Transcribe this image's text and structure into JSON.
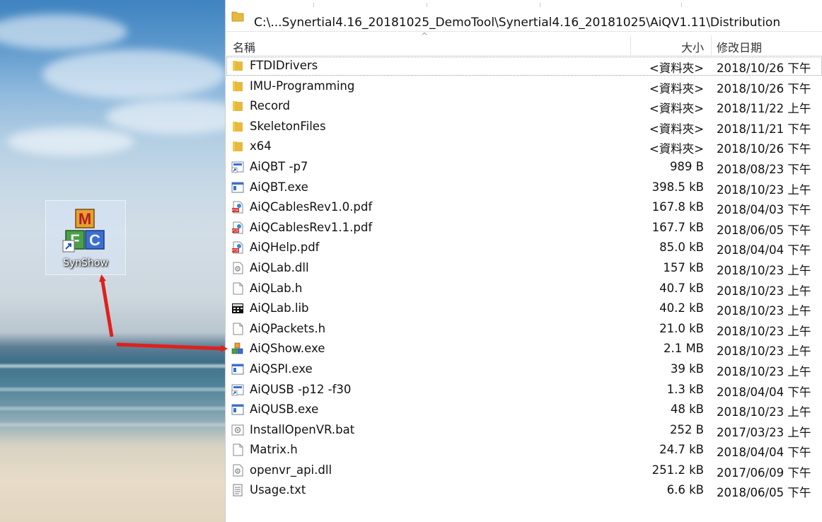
{
  "desktop": {
    "shortcut_label": "SynShow"
  },
  "explorer": {
    "path": "C:\\...Synertial4.16_20181025_DemoTool\\Synertial4.16_20181025\\AiQV1.11\\Distribution",
    "columns": {
      "name": "名稱",
      "size": "大小",
      "date": "修改日期"
    },
    "files": [
      {
        "name": "FTDIDrivers",
        "size": "<資料夾>",
        "date": "2018/10/26 下午",
        "icon": "folder-icon"
      },
      {
        "name": "IMU-Programming",
        "size": "<資料夾>",
        "date": "2018/10/26 下午",
        "icon": "folder-icon"
      },
      {
        "name": "Record",
        "size": "<資料夾>",
        "date": "2018/11/22 上午",
        "icon": "folder-icon"
      },
      {
        "name": "SkeletonFiles",
        "size": "<資料夾>",
        "date": "2018/11/21 下午",
        "icon": "folder-icon"
      },
      {
        "name": "x64",
        "size": "<資料夾>",
        "date": "2018/10/26 下午",
        "icon": "folder-icon"
      },
      {
        "name": "AiQBT -p7",
        "size": "989 B",
        "date": "2018/08/23 下午",
        "icon": "shortcut-icon"
      },
      {
        "name": "AiQBT.exe",
        "size": "398.5 kB",
        "date": "2018/10/23 上午",
        "icon": "exe-icon"
      },
      {
        "name": "AiQCablesRev1.0.pdf",
        "size": "167.8 kB",
        "date": "2018/04/03 下午",
        "icon": "pdf-icon"
      },
      {
        "name": "AiQCablesRev1.1.pdf",
        "size": "167.7 kB",
        "date": "2018/06/05 下午",
        "icon": "pdf-icon"
      },
      {
        "name": "AiQHelp.pdf",
        "size": "85.0 kB",
        "date": "2018/04/04 下午",
        "icon": "pdf-icon"
      },
      {
        "name": "AiQLab.dll",
        "size": "157 kB",
        "date": "2018/10/23 上午",
        "icon": "dll-icon"
      },
      {
        "name": "AiQLab.h",
        "size": "40.7 kB",
        "date": "2018/10/23 上午",
        "icon": "file-icon"
      },
      {
        "name": "AiQLab.lib",
        "size": "40.2 kB",
        "date": "2018/10/23 上午",
        "icon": "lib-icon"
      },
      {
        "name": "AiQPackets.h",
        "size": "21.0 kB",
        "date": "2018/10/23 上午",
        "icon": "file-icon"
      },
      {
        "name": "AiQShow.exe",
        "size": "2.1 MB",
        "date": "2018/10/23 上午",
        "icon": "mfc-app-icon"
      },
      {
        "name": "AiQSPI.exe",
        "size": "39 kB",
        "date": "2018/10/23 上午",
        "icon": "exe-icon"
      },
      {
        "name": "AiQUSB -p12 -f30",
        "size": "1.3 kB",
        "date": "2018/04/04 下午",
        "icon": "shortcut-icon"
      },
      {
        "name": "AiQUSB.exe",
        "size": "48 kB",
        "date": "2018/10/23 上午",
        "icon": "exe-icon"
      },
      {
        "name": "InstallOpenVR.bat",
        "size": "252 B",
        "date": "2017/03/23 上午",
        "icon": "bat-icon"
      },
      {
        "name": "Matrix.h",
        "size": "24.7 kB",
        "date": "2018/04/04 下午",
        "icon": "file-icon"
      },
      {
        "name": "openvr_api.dll",
        "size": "251.2 kB",
        "date": "2017/06/09 下午",
        "icon": "dll-icon"
      },
      {
        "name": "Usage.txt",
        "size": "6.6 kB",
        "date": "2018/06/05 下午",
        "icon": "txt-icon"
      }
    ]
  },
  "colors": {
    "folder": "#e8b93c",
    "annotation_arrow": "#e0201c",
    "selection_dotted": "#999999"
  }
}
